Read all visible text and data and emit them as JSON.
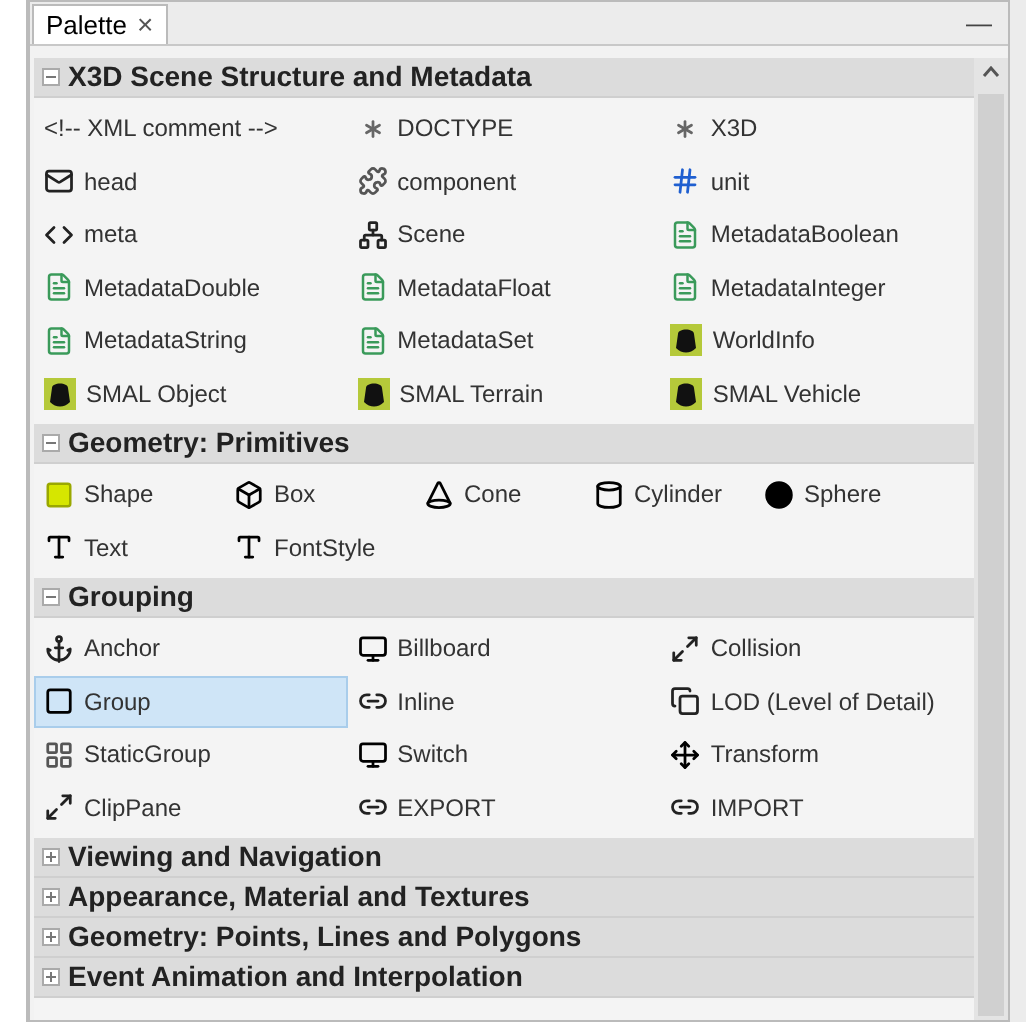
{
  "tab": {
    "label": "Palette",
    "close": "×",
    "selected": true
  },
  "minimize": "—",
  "sections": [
    {
      "title": "X3D Scene Structure and Metadata",
      "expanded": true,
      "kind": "three-column",
      "items": [
        {
          "label": "<!-- XML comment -->",
          "selected": false
        },
        {
          "label": "DOCTYPE",
          "selected": false
        },
        {
          "label": "X3D",
          "selected": false
        },
        {
          "label": "head",
          "selected": false
        },
        {
          "label": "component",
          "selected": false
        },
        {
          "label": "unit",
          "selected": false
        },
        {
          "label": "meta",
          "selected": false
        },
        {
          "label": "Scene",
          "selected": false
        },
        {
          "label": "MetadataBoolean",
          "selected": false
        },
        {
          "label": "MetadataDouble",
          "selected": false
        },
        {
          "label": "MetadataFloat",
          "selected": false
        },
        {
          "label": "MetadataInteger",
          "selected": false
        },
        {
          "label": "MetadataString",
          "selected": false
        },
        {
          "label": "MetadataSet",
          "selected": false
        },
        {
          "label": "WorldInfo",
          "selected": false
        },
        {
          "label": "SMAL Object",
          "selected": false
        },
        {
          "label": "SMAL Terrain",
          "selected": false
        },
        {
          "label": "SMAL Vehicle",
          "selected": false
        }
      ]
    },
    {
      "title": "Geometry: Primitives",
      "expanded": true,
      "kind": "five-column",
      "items": [
        {
          "label": "Shape",
          "selected": false
        },
        {
          "label": "Box",
          "selected": false
        },
        {
          "label": "Cone",
          "selected": false
        },
        {
          "label": "Cylinder",
          "selected": false
        },
        {
          "label": "Sphere",
          "selected": false
        },
        {
          "label": "Text",
          "selected": false
        },
        {
          "label": "FontStyle",
          "selected": false
        }
      ]
    },
    {
      "title": "Grouping",
      "expanded": true,
      "kind": "three-column",
      "items": [
        {
          "label": "Anchor",
          "selected": false
        },
        {
          "label": "Billboard",
          "selected": false
        },
        {
          "label": "Collision",
          "selected": false
        },
        {
          "label": "Group",
          "selected": true
        },
        {
          "label": "Inline",
          "selected": false
        },
        {
          "label": "LOD (Level of Detail)",
          "selected": false
        },
        {
          "label": "StaticGroup",
          "selected": false
        },
        {
          "label": "Switch",
          "selected": false
        },
        {
          "label": "Transform",
          "selected": false
        },
        {
          "label": "ClipPane",
          "selected": false
        },
        {
          "label": "EXPORT",
          "selected": false
        },
        {
          "label": "IMPORT",
          "selected": false
        }
      ]
    },
    {
      "title": "Viewing and Navigation",
      "expanded": false,
      "kind": "three-column"
    },
    {
      "title": "Appearance, Material and Textures",
      "expanded": false,
      "kind": "three-column"
    },
    {
      "title": "Geometry: Points, Lines and Polygons",
      "expanded": false,
      "kind": "three-column"
    },
    {
      "title": "Event Animation and Interpolation",
      "expanded": false,
      "kind": "three-column"
    }
  ]
}
